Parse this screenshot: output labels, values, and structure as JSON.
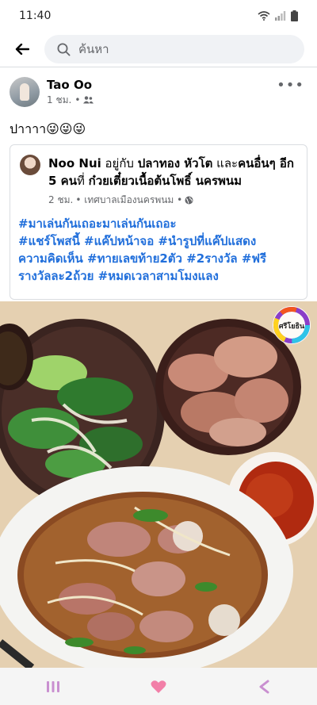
{
  "status_bar": {
    "time": "11:40"
  },
  "search": {
    "placeholder": "ค้นหา"
  },
  "post": {
    "author": "Tao Oo",
    "time": "1 ชม.",
    "separator": "•",
    "text": "ปาาาา😜😜😜"
  },
  "shared": {
    "author": "Noo Nui",
    "with_word": " อยู่กับ ",
    "tagged": "ปลาทอง หัวโต",
    "and_word": " และ",
    "others": "คนอื่นๆ อีก 5 คน",
    "at_word": "ที่ ",
    "place": "ก๋วยเตี๋ยวเนื้อต้นโพธิ์ นครพนม",
    "time": "2 ชม.",
    "location": "• เทศบาลเมืองนครพนม •",
    "hashtag_lines": [
      "#มาเล่นกันเถอะมาเล่นกันเถอะ",
      "#แชร์โพสนี้  #แค๊ปหน้าจอ #นำรูปที่แค๊ปแสดง",
      "ความคิดเห็น #ทายเลขท้าย2ตัว #2รางวัล #ฟรี",
      "รางวัลละ2ถ้วย #หมดเวลาสามโมงแลง"
    ]
  },
  "photo": {
    "watermark": "ศรีโยธิน"
  },
  "icons": {
    "back": "arrow-left-icon",
    "search": "search-icon",
    "more": "more-options-icon",
    "friends": "friends-audience-icon",
    "globe": "globe-icon",
    "wifi": "wifi-icon",
    "signal": "signal-icon",
    "battery": "battery-icon",
    "recents": "recents-icon",
    "home": "home-icon",
    "back_nav": "back-nav-icon"
  },
  "colors": {
    "hashtag": "#216fdb",
    "meta": "#65676b",
    "search_bg": "#f0f2f5",
    "nav_heart": "#f27fa8",
    "nav_icon": "#c98fd0"
  }
}
